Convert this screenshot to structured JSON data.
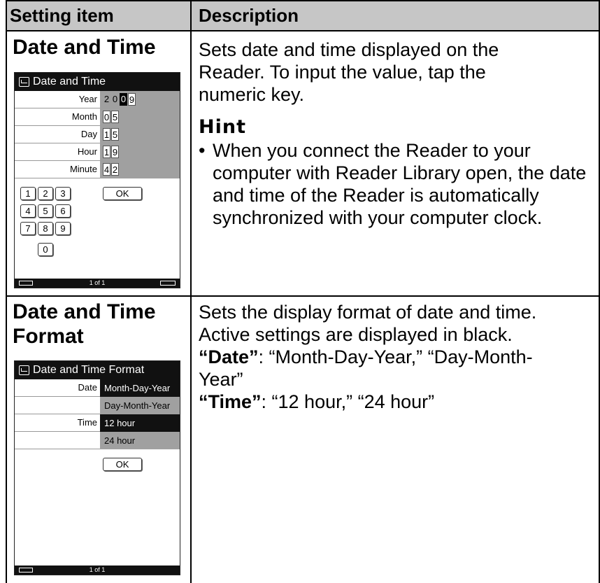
{
  "header": {
    "col1": "Setting item",
    "col2": "Description"
  },
  "rows": [
    {
      "title_line1": "Date and Time",
      "desc": [
        "Sets date and time displayed on the",
        "Reader. To input the value, tap the",
        "numeric key."
      ],
      "hint_title": "Hint",
      "hint": [
        "When you connect the Reader to your",
        "computer with Reader Library open, the date",
        "and time of the Reader is automatically",
        "synchronized with your computer clock."
      ],
      "bullet": "•",
      "screen": {
        "title": "Date and Time",
        "fields": [
          {
            "label": "Year",
            "digits": [
              "2",
              "0",
              "0",
              "9"
            ]
          },
          {
            "label": "Month",
            "digits": [
              "0",
              "5"
            ]
          },
          {
            "label": "Day",
            "digits": [
              "1",
              "5"
            ]
          },
          {
            "label": "Hour",
            "digits": [
              "1",
              "9"
            ]
          },
          {
            "label": "Minute",
            "digits": [
              "4",
              "2"
            ]
          }
        ],
        "keys": [
          "1",
          "2",
          "3",
          "OK",
          "4",
          "5",
          "6",
          "7",
          "8",
          "9",
          "0"
        ],
        "page": "1 of 1"
      }
    },
    {
      "title_line1": "Date and Time",
      "title_line2": "Format",
      "desc1": "Sets the display format of date and time.",
      "desc2": "Active settings are displayed in black.",
      "date_label": "“Date”",
      "date_text": ": “Month-Day-Year,” “Day-Month-",
      "date_text2": "Year”",
      "time_label": "“Time”",
      "time_text": ": “12 hour,” “24 hour”",
      "screen": {
        "title": "Date and Time Format",
        "date_label": "Date",
        "time_label": "Time",
        "date_opts": [
          "Month-Day-Year",
          "Day-Month-Year"
        ],
        "time_opts": [
          "12 hour",
          "24 hour"
        ],
        "ok": "OK",
        "page": "1 of 1"
      }
    }
  ]
}
